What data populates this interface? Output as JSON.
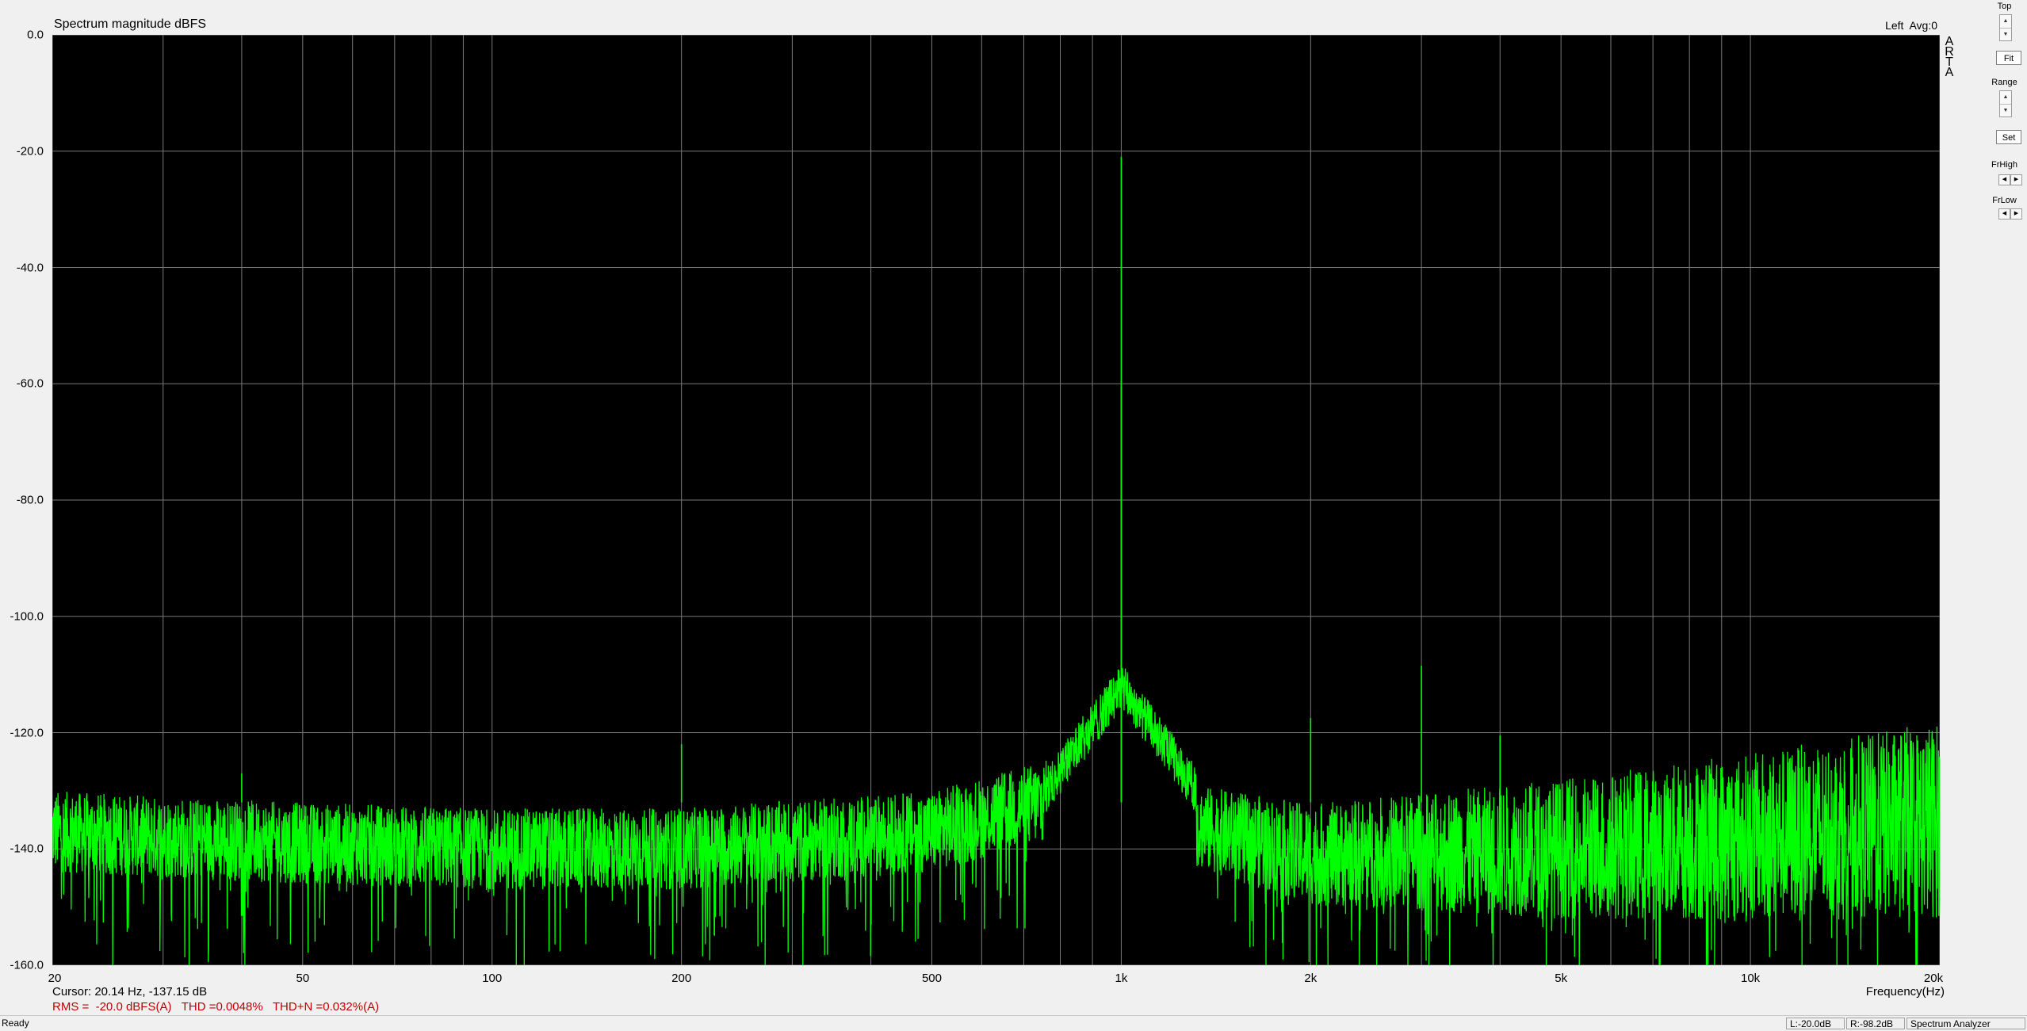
{
  "window": {
    "title": "Spectrum magnitude dBFS",
    "channel_avg": "Left  Avg:0",
    "arta_letters": [
      "A",
      "R",
      "T",
      "A"
    ]
  },
  "chart_data": {
    "type": "line",
    "title": "Spectrum magnitude dBFS",
    "xlabel": "Frequency(Hz)",
    "ylabel": "",
    "xscale": "log",
    "xlim": [
      20,
      20000
    ],
    "ylim": [
      -160,
      0
    ],
    "grid": true,
    "background": "#000000",
    "grid_color": "#7a7a7a",
    "line_color": "#00ff00",
    "y_ticks": [
      "0.0",
      "-20.0",
      "-40.0",
      "-60.0",
      "-80.0",
      "-100.0",
      "-120.0",
      "-140.0",
      "-160.0"
    ],
    "x_ticks": [
      {
        "v": 20,
        "label": "20"
      },
      {
        "v": 50,
        "label": "50"
      },
      {
        "v": 100,
        "label": "100"
      },
      {
        "v": 200,
        "label": "200"
      },
      {
        "v": 500,
        "label": "500"
      },
      {
        "v": 1000,
        "label": "1k"
      },
      {
        "v": 2000,
        "label": "2k"
      },
      {
        "v": 5000,
        "label": "5k"
      },
      {
        "v": 10000,
        "label": "10k"
      },
      {
        "v": 20000,
        "label": "20k"
      }
    ],
    "series": [
      {
        "values": {
          "noise_floor_envelope": [
            [
              20,
              -137
            ],
            [
              30,
              -138
            ],
            [
              50,
              -139
            ],
            [
              100,
              -140
            ],
            [
              200,
              -140
            ],
            [
              500,
              -137
            ],
            [
              800,
              -131
            ],
            [
              1000,
              -126
            ],
            [
              1300,
              -136
            ],
            [
              2000,
              -141
            ],
            [
              5000,
              -140
            ],
            [
              10000,
              -138
            ],
            [
              20000,
              -135
            ]
          ],
          "peaks": [
            [
              1000,
              -21.0
            ],
            [
              1000,
              -60.5
            ],
            [
              2000,
              -117.5
            ],
            [
              3000,
              -108.5
            ],
            [
              4000,
              -120.5
            ],
            [
              40,
              -127
            ],
            [
              200,
              -122
            ]
          ]
        }
      }
    ]
  },
  "readouts": {
    "cursor": "Cursor: 20.14 Hz, -137.15 dB",
    "stats": "RMS =  -20.0 dBFS(A)   THD =0.0048%   THD+N =0.032%(A)"
  },
  "controls": {
    "top_label": "Top",
    "fit_label": "Fit",
    "range_label": "Range",
    "set_label": "Set",
    "frhigh_label": "FrHigh",
    "frlow_label": "FrLow"
  },
  "statusbar": {
    "ready": "Ready",
    "left_level": "L:-20.0dB",
    "right_level": "R:-98.2dB",
    "mode": "Spectrum Analyzer"
  }
}
